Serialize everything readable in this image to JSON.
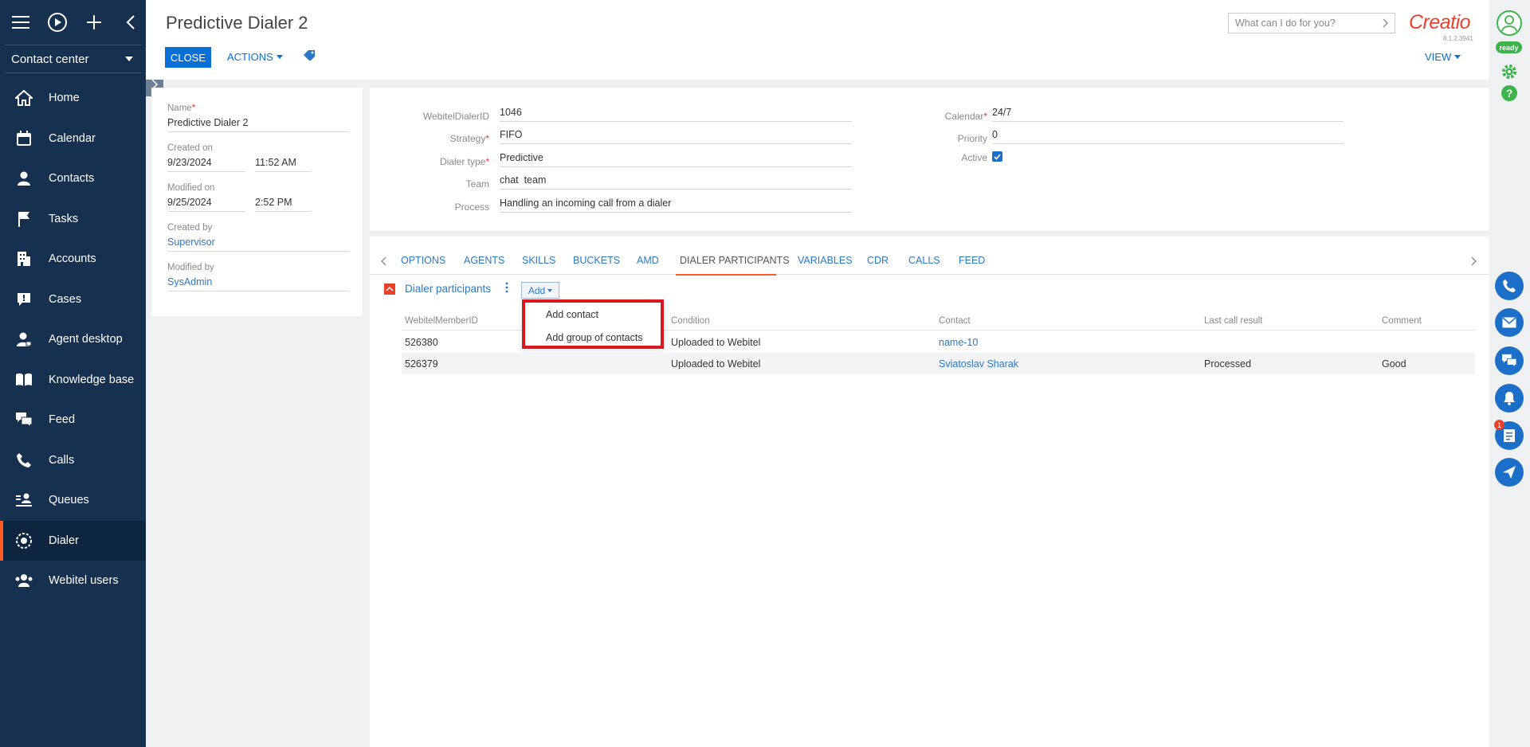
{
  "sidebar": {
    "workspace": "Contact center",
    "items": [
      {
        "label": "Home",
        "icon": "home-icon"
      },
      {
        "label": "Calendar",
        "icon": "calendar-icon"
      },
      {
        "label": "Contacts",
        "icon": "contact-icon"
      },
      {
        "label": "Tasks",
        "icon": "flag-icon"
      },
      {
        "label": "Accounts",
        "icon": "building-icon"
      },
      {
        "label": "Cases",
        "icon": "chat-alert-icon"
      },
      {
        "label": "Agent desktop",
        "icon": "agent-icon"
      },
      {
        "label": "Knowledge base",
        "icon": "book-icon"
      },
      {
        "label": "Feed",
        "icon": "feed-icon"
      },
      {
        "label": "Calls",
        "icon": "phone-icon"
      },
      {
        "label": "Queues",
        "icon": "queue-icon"
      },
      {
        "label": "Dialer",
        "icon": "dialer-icon",
        "active": true
      },
      {
        "label": "Webitel users",
        "icon": "users-icon"
      }
    ]
  },
  "header": {
    "title": "Predictive Dialer 2",
    "close_label": "CLOSE",
    "actions_label": "ACTIONS",
    "search_placeholder": "What can I do for you?",
    "brand": "Creatio",
    "version": "8.1.2.3941",
    "view_label": "VIEW"
  },
  "status": {
    "label": "ready",
    "color": "#3bb54a"
  },
  "info": {
    "name_label": "Name",
    "name_value": "Predictive Dialer 2",
    "created_on_label": "Created on",
    "created_date": "9/23/2024",
    "created_time": "11:52 AM",
    "modified_on_label": "Modified on",
    "modified_date": "9/25/2024",
    "modified_time": "2:52 PM",
    "created_by_label": "Created by",
    "created_by_value": "Supervisor",
    "modified_by_label": "Modified by",
    "modified_by_value": "SysAdmin"
  },
  "fields": {
    "dialer_id_label": "WebitelDialerID",
    "dialer_id_value": "1046",
    "strategy_label": "Strategy",
    "strategy_value": "FIFO",
    "dialer_type_label": "Dialer type",
    "dialer_type_value": "Predictive",
    "team_label": "Team",
    "team_value": "chat  team",
    "process_label": "Process",
    "process_value": "Handling an incoming call from a dialer",
    "calendar_label": "Calendar",
    "calendar_value": "24/7",
    "priority_label": "Priority",
    "priority_value": "0",
    "active_label": "Active",
    "active_checked": true
  },
  "tabs": [
    "OPTIONS",
    "AGENTS",
    "SKILLS",
    "BUCKETS",
    "AMD",
    "DIALER PARTICIPANTS",
    "VARIABLES",
    "CDR",
    "CALLS",
    "FEED"
  ],
  "active_tab": "DIALER PARTICIPANTS",
  "participants": {
    "title": "Dialer participants",
    "add_label": "Add",
    "columns": [
      "WebitelMemberID",
      "Condition",
      "Contact",
      "Last call result",
      "Comment"
    ],
    "rows": [
      {
        "id": "526380",
        "condition": "Uploaded to Webitel",
        "contact": "name-10",
        "result": "",
        "comment": ""
      },
      {
        "id": "526379",
        "condition": "Uploaded to Webitel",
        "contact": "Sviatoslav Sharak",
        "result": "Processed",
        "comment": "Good"
      }
    ]
  },
  "add_menu": {
    "items": [
      "Add contact",
      "Add group of contacts"
    ],
    "highlight_color": "#d7191f"
  },
  "notifications_badge": "1",
  "colors": {
    "sidebar": "#16304f",
    "accent": "#ff5a1f",
    "primary": "#0b6fd8",
    "brand": "#e8412c"
  }
}
